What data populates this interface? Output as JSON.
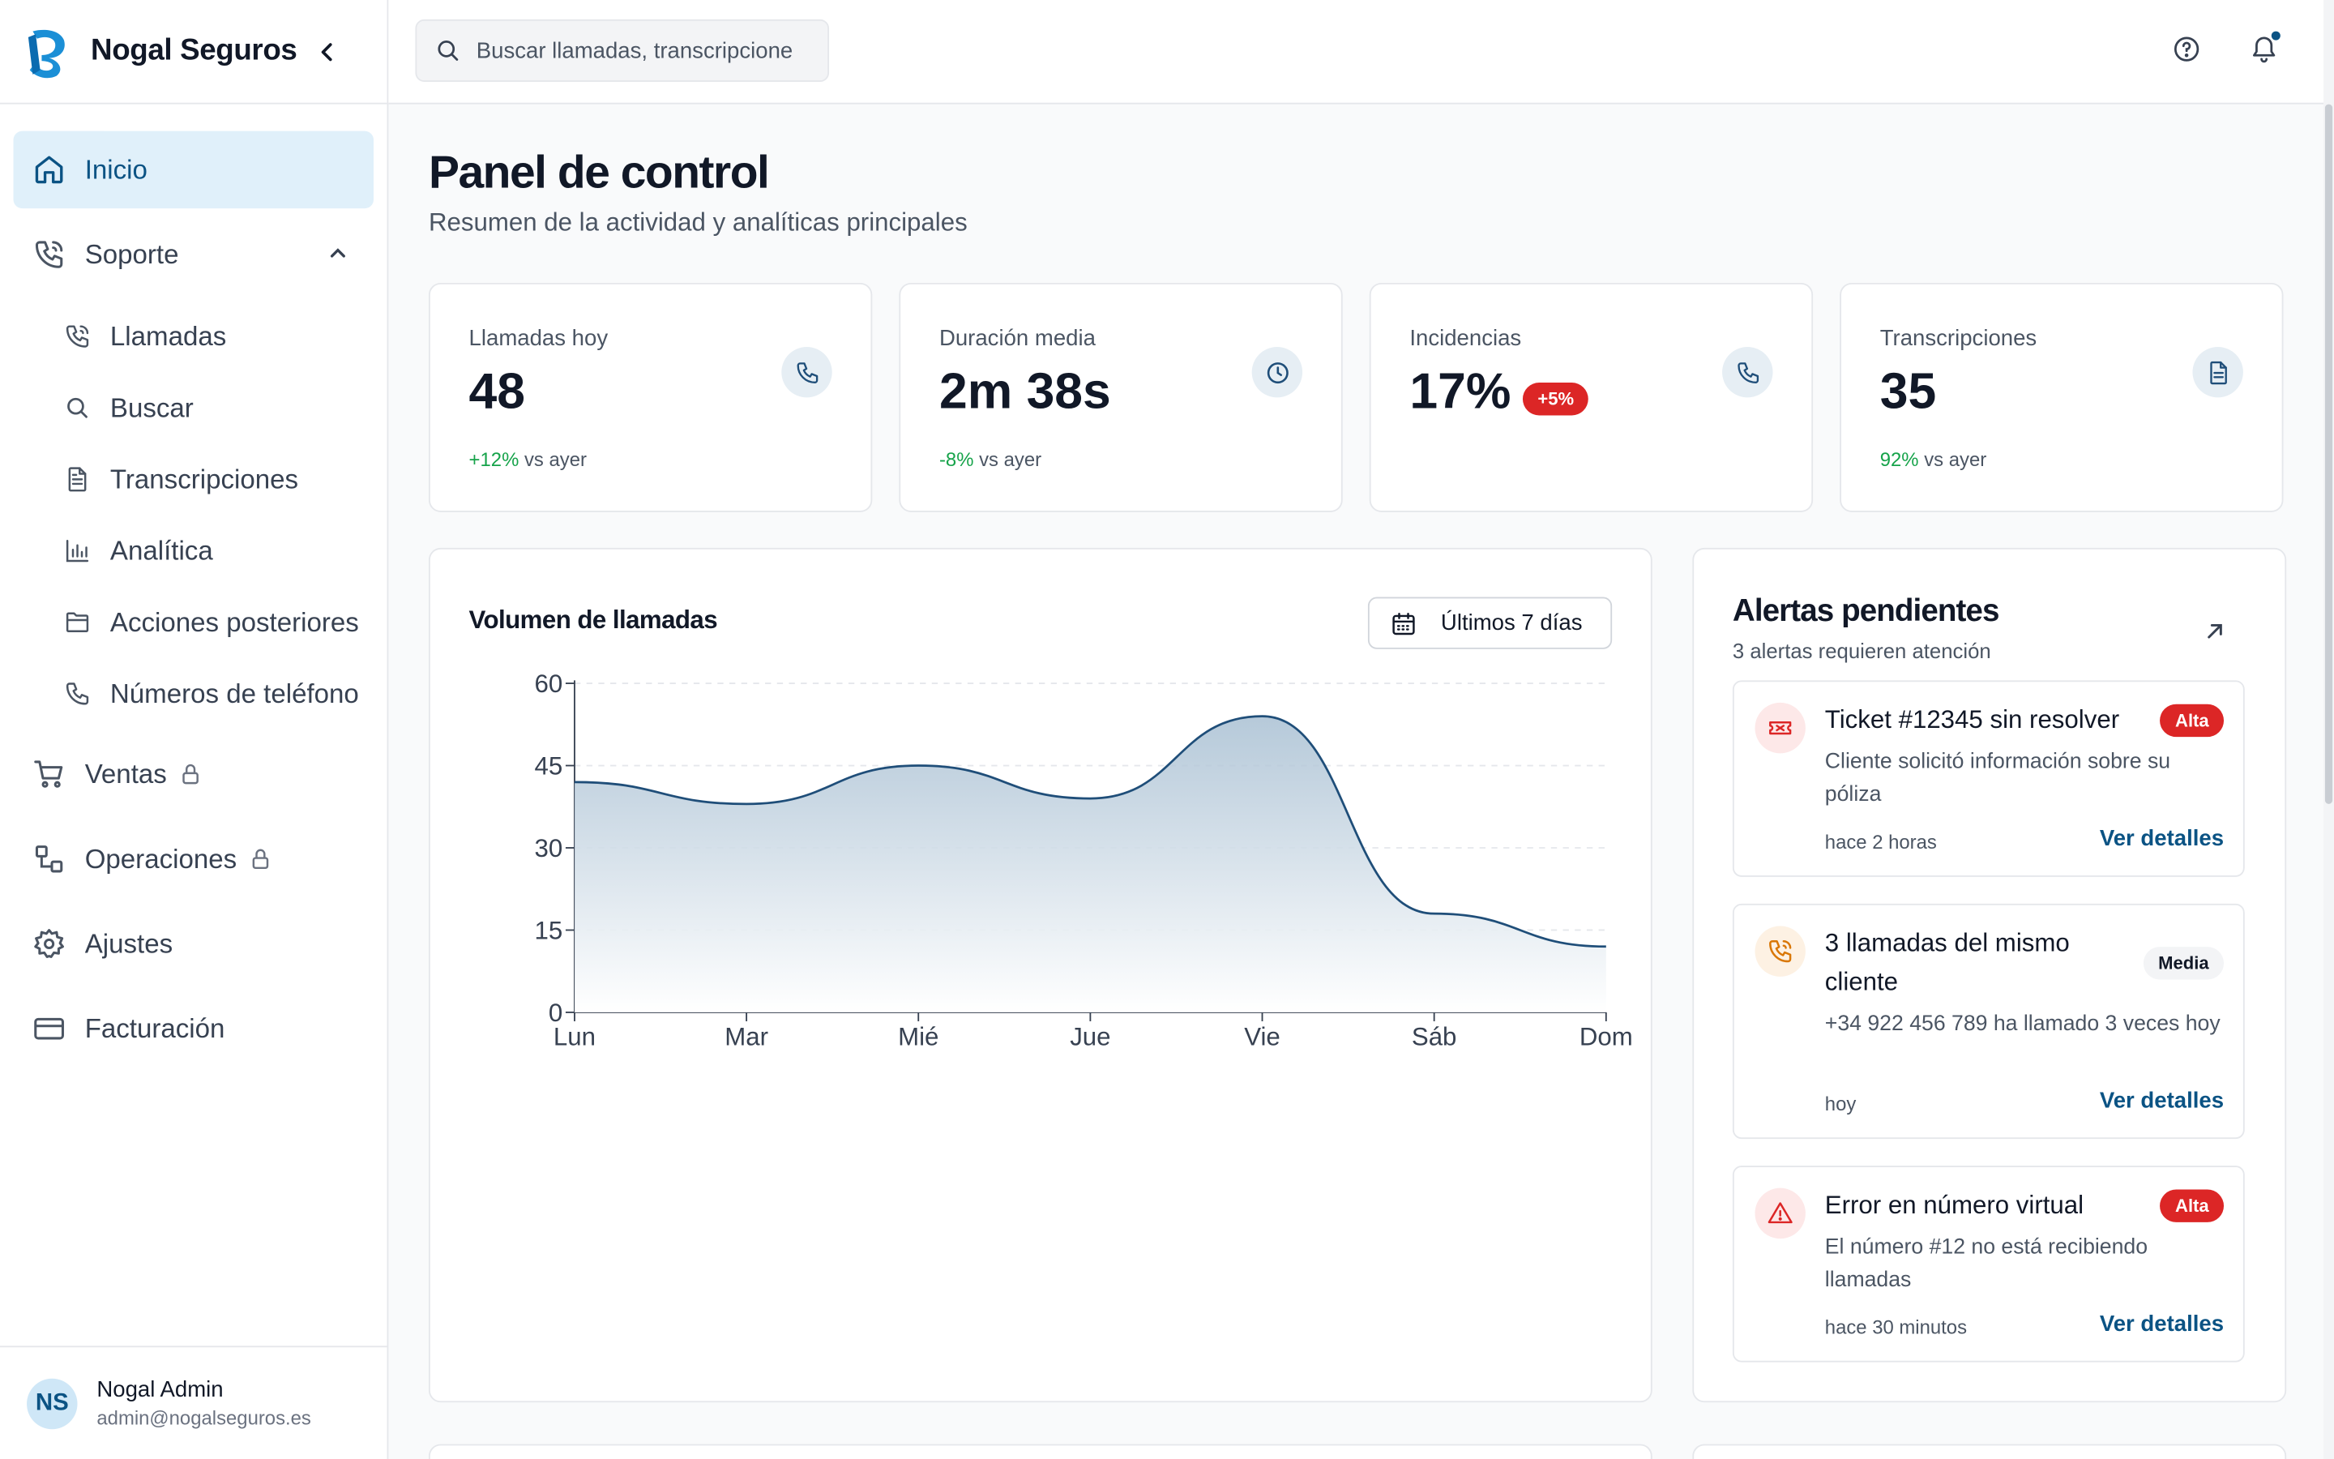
{
  "brand": {
    "name": "Nogal Seguros"
  },
  "search": {
    "placeholder": "Buscar llamadas, transcripcione"
  },
  "nav": {
    "inicio": "Inicio",
    "soporte": "Soporte",
    "sub": {
      "llamadas": "Llamadas",
      "buscar": "Buscar",
      "transcripciones": "Transcripciones",
      "analitica": "Analítica",
      "acciones": "Acciones posteriores",
      "numeros": "Números de teléfono"
    },
    "ventas": "Ventas",
    "operaciones": "Operaciones",
    "ajustes": "Ajustes",
    "facturacion": "Facturación"
  },
  "user": {
    "initials": "NS",
    "name": "Nogal Admin",
    "email": "admin@nogalseguros.es"
  },
  "page": {
    "title": "Panel de control",
    "subtitle": "Resumen de la actividad y analíticas principales"
  },
  "stats": [
    {
      "label": "Llamadas hoy",
      "value": "48",
      "change": "+12%",
      "suffix": "vs ayer",
      "icon": "phone-icon"
    },
    {
      "label": "Duración media",
      "value": "2m 38s",
      "change": "-8%",
      "suffix": "vs ayer",
      "icon": "clock-icon"
    },
    {
      "label": "Incidencias",
      "value": "17%",
      "badge": "+5%",
      "icon": "phone-icon"
    },
    {
      "label": "Transcripciones",
      "value": "35",
      "change": "92%",
      "suffix": "vs ayer",
      "icon": "document-icon"
    }
  ],
  "chart": {
    "title": "Volumen de llamadas",
    "range": "Últimos 7 días"
  },
  "chart_data": {
    "type": "area",
    "title": "Volumen de llamadas",
    "categories": [
      "Lun",
      "Mar",
      "Mié",
      "Jue",
      "Vie",
      "Sáb",
      "Dom"
    ],
    "values": [
      42,
      38,
      45,
      39,
      54,
      18,
      12
    ],
    "ylim": [
      0,
      60
    ],
    "yticks": [
      0,
      15,
      30,
      45,
      60
    ],
    "grid": true,
    "colors": {
      "line": "#1f4e79",
      "fill_top": "#a9c0d3",
      "fill_bottom": "#ffffff"
    }
  },
  "alerts": {
    "title": "Alertas pendientes",
    "subtitle": "3 alertas requieren atención",
    "items": [
      {
        "title": "Ticket #12345 sin resolver",
        "desc": "Cliente solicitó información sobre su póliza",
        "time": "hace 2 horas",
        "priority": "Alta",
        "link": "Ver detalles",
        "icon": "ticket-icon"
      },
      {
        "title": "3 llamadas del mismo cliente",
        "desc": "+34 922 456 789 ha llamado 3 veces hoy",
        "time": "hoy",
        "priority": "Media",
        "link": "Ver detalles",
        "icon": "phone-call-icon"
      },
      {
        "title": "Error en número virtual",
        "desc": "El número #12 no está recibiendo llamadas",
        "time": "hace 30 minutos",
        "priority": "Alta",
        "link": "Ver detalles",
        "icon": "warning-icon"
      }
    ]
  }
}
